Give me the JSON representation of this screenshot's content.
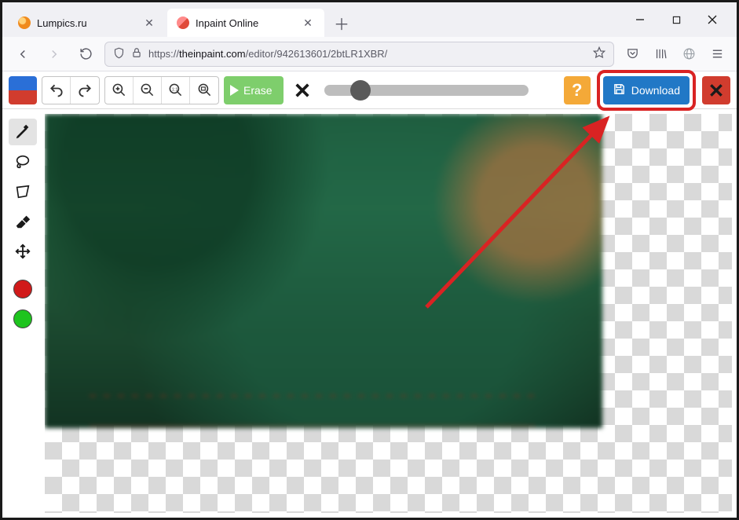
{
  "browser": {
    "tabs": [
      {
        "title": "Lumpics.ru",
        "favicon": "#f08a1d",
        "active": false
      },
      {
        "title": "Inpaint Online",
        "favicon": "#e04a3a",
        "active": true
      }
    ],
    "url_prefix": "https://",
    "url_host": "theinpaint.com",
    "url_path": "/editor/942613601/2btLR1XBR/"
  },
  "toolbar": {
    "erase_label": "Erase",
    "download_label": "Download",
    "help_label": "?",
    "brush_slider_percent": 18
  },
  "sidebar": {
    "tools": [
      "marker",
      "lasso",
      "polygon",
      "eraser",
      "move"
    ],
    "colors": [
      "#d11a1a",
      "#1ec41e"
    ]
  },
  "annotation": {
    "highlight_color": "#d92323"
  }
}
